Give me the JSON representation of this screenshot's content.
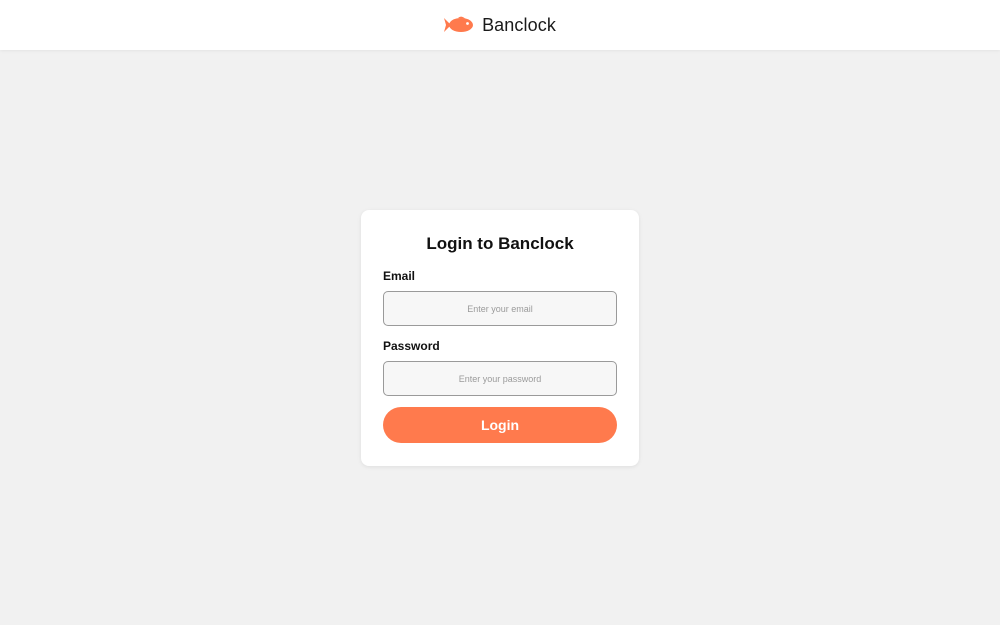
{
  "header": {
    "brand_name": "Banclock",
    "logo_icon": "fish-icon",
    "brand_color": "#ff7a4d"
  },
  "login_form": {
    "title": "Login to Banclock",
    "email_label": "Email",
    "email_value": "",
    "email_placeholder": "Enter your email",
    "password_label": "Password",
    "password_value": "",
    "password_placeholder": "Enter your password",
    "submit_label": "Login"
  },
  "colors": {
    "accent": "#ff7a4d",
    "background": "#f1f1f1",
    "card": "#ffffff"
  }
}
